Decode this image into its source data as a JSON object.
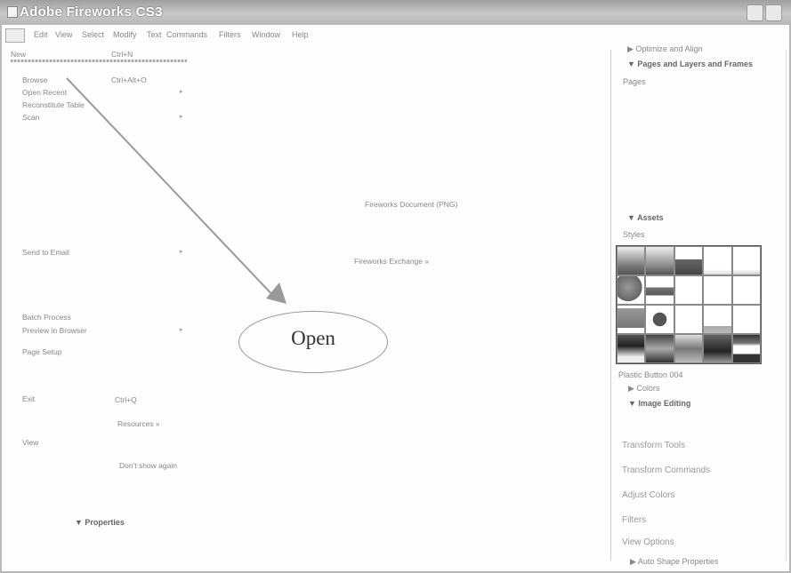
{
  "window": {
    "title": "Adobe Fireworks CS3"
  },
  "menubar": {
    "items": [
      "Edit",
      "View",
      "Select",
      "Modify",
      "Text",
      "Commands",
      "Filters",
      "Window",
      "Help"
    ]
  },
  "file_menu": {
    "items": [
      {
        "label": "New",
        "shortcut": "Ctrl+N"
      },
      {
        "label": "Browse",
        "shortcut": "Ctrl+Alt+O"
      },
      {
        "label": "Open Recent",
        "submenu": true
      },
      {
        "label": "Reconstitute Table"
      },
      {
        "label": "Scan",
        "submenu": true
      },
      {
        "label": "Send to Email",
        "submenu": true
      },
      {
        "label": "Batch Process"
      },
      {
        "label": "Preview in Browser",
        "submenu": true
      },
      {
        "label": "Page Setup"
      }
    ],
    "submenu_glyph": "▸"
  },
  "start_page": {
    "fw_document": "Fireworks Document (PNG)",
    "fw_exchange": "Fireworks Exchange »",
    "exit_label": "Exit",
    "exit_shortcut": "Ctrl+Q",
    "resources": "Resources »",
    "view": "View",
    "dont_show": "Don't show again"
  },
  "annotation": {
    "open_label": "Open"
  },
  "properties": {
    "header": "▼ Properties"
  },
  "right_panel": {
    "optimize": "▶ Optimize and Align",
    "pages_layers": "▼ Pages and Layers and Frames",
    "pages": "Pages",
    "assets": "▼ Assets",
    "styles": "Styles",
    "style_name": "Plastic Button 004",
    "colors": "▶ Colors",
    "image_editing": "▼ Image Editing",
    "items": [
      "Transform Tools",
      "Transform Commands",
      "Adjust Colors",
      "Filters",
      "View Options"
    ],
    "auto_shape": "▶ Auto Shape Properties"
  }
}
